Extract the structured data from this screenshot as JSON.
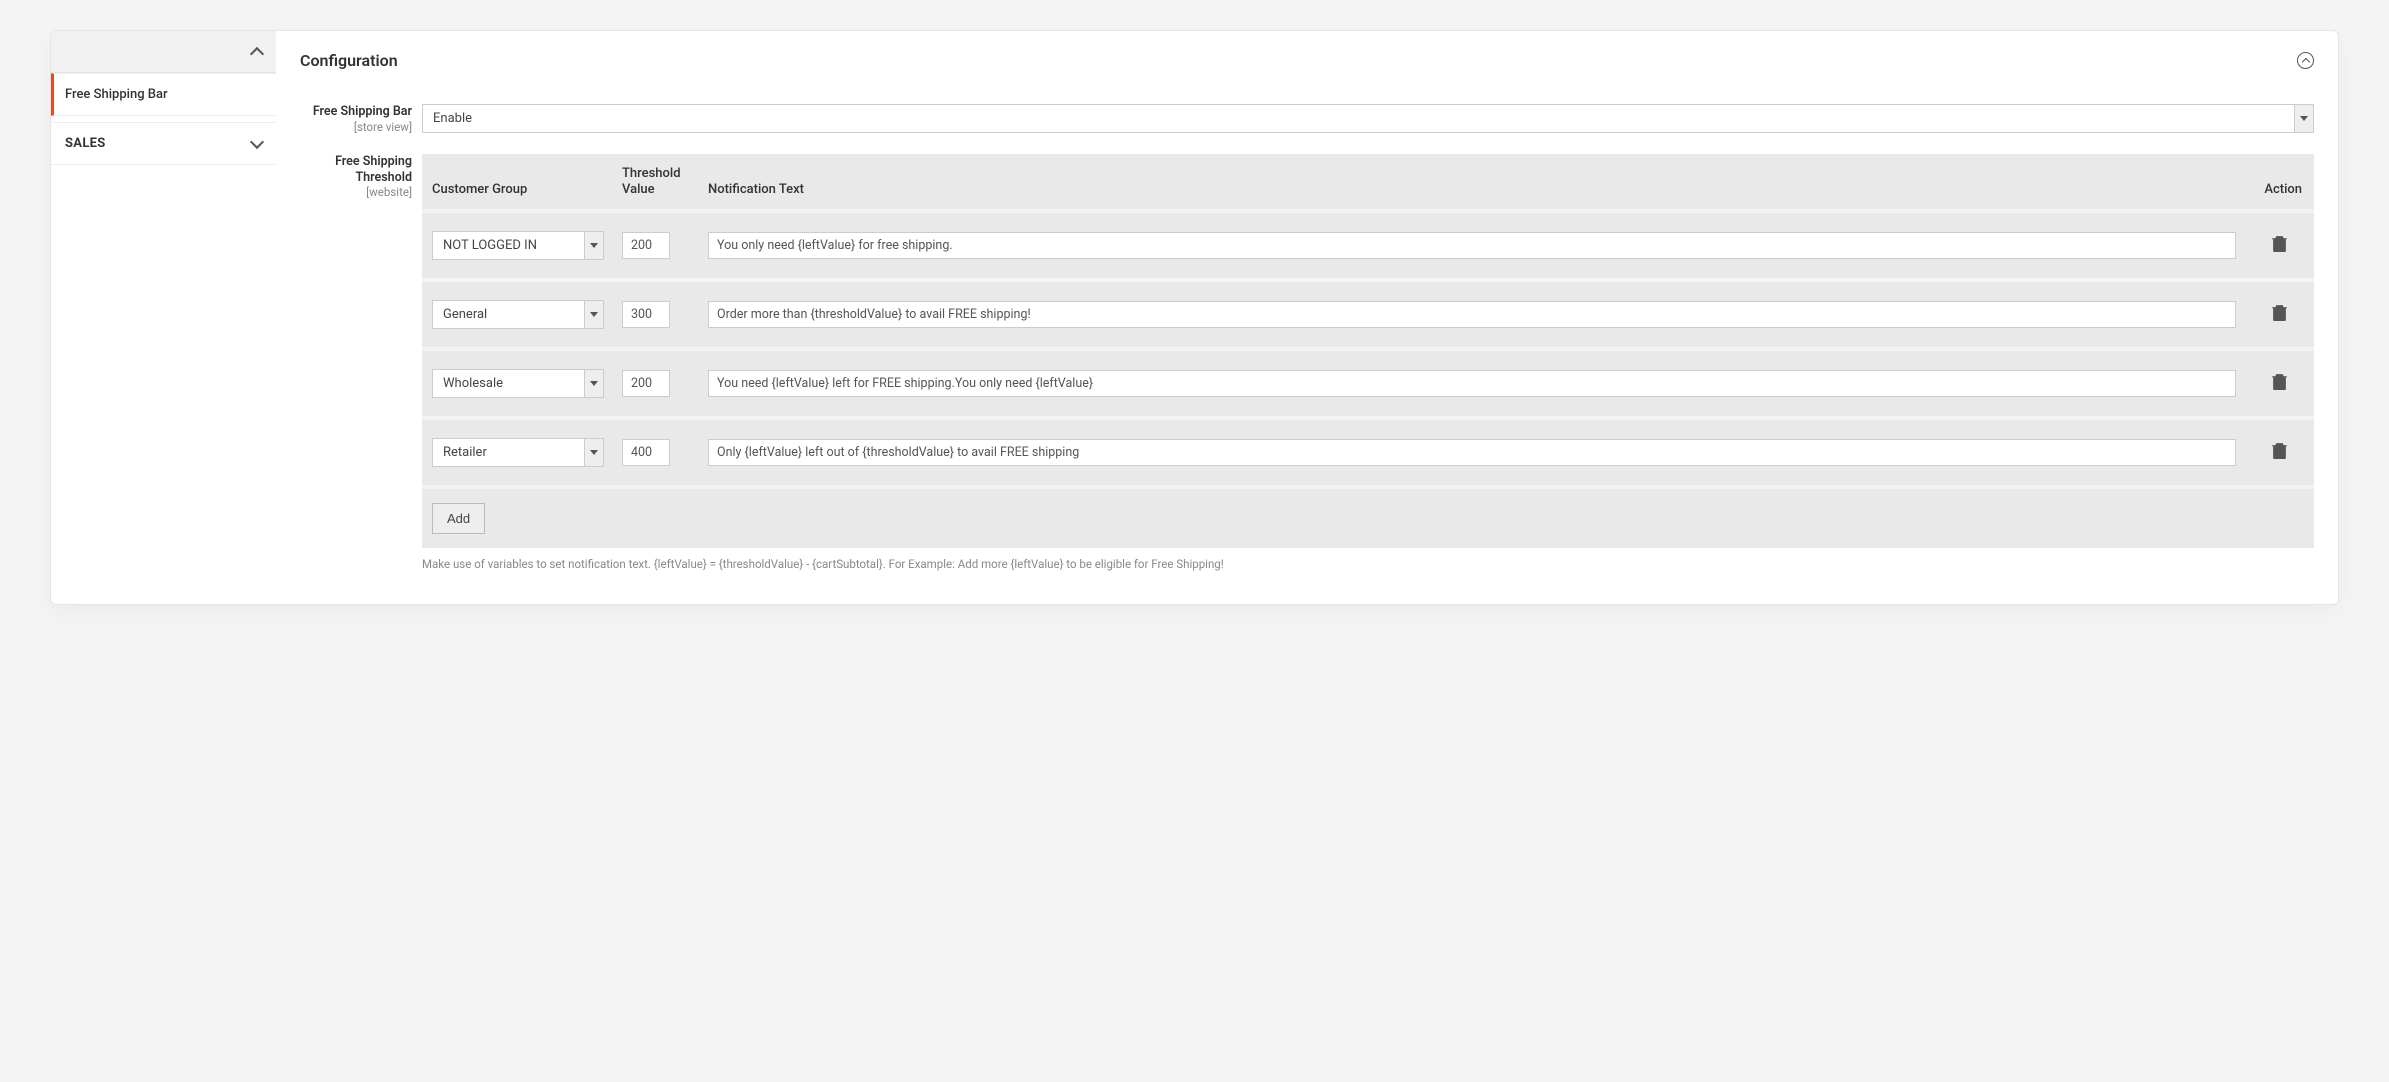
{
  "sidebar": {
    "items": [
      {
        "label": "Free Shipping Bar",
        "active": true
      },
      {
        "label": "SALES",
        "section": true
      }
    ]
  },
  "main": {
    "title": "Configuration",
    "fields": {
      "fsb": {
        "label": "Free Shipping Bar",
        "scope": "[store view]",
        "value": "Enable"
      },
      "threshold": {
        "label": "Free Shipping Threshold",
        "scope": "[website]",
        "headers": {
          "group": "Customer Group",
          "value": "Threshold Value",
          "text": "Notification Text",
          "action": "Action"
        },
        "rows": [
          {
            "group": "NOT LOGGED IN",
            "value": "200",
            "text": "You only need {leftValue} for free shipping."
          },
          {
            "group": "General",
            "value": "300",
            "text": "Order more than {thresholdValue} to avail FREE shipping!"
          },
          {
            "group": "Wholesale",
            "value": "200",
            "text": "You need {leftValue} left for FREE shipping.You only need {leftValue}"
          },
          {
            "group": "Retailer",
            "value": "400",
            "text": "Only {leftValue} left out of {thresholdValue} to avail FREE shipping"
          }
        ],
        "add_label": "Add",
        "help": "Make use of variables to set notification text. {leftValue} = {thresholdValue} - {cartSubtotal}. For Example: Add more {leftValue} to be eligible for Free Shipping!"
      }
    }
  }
}
